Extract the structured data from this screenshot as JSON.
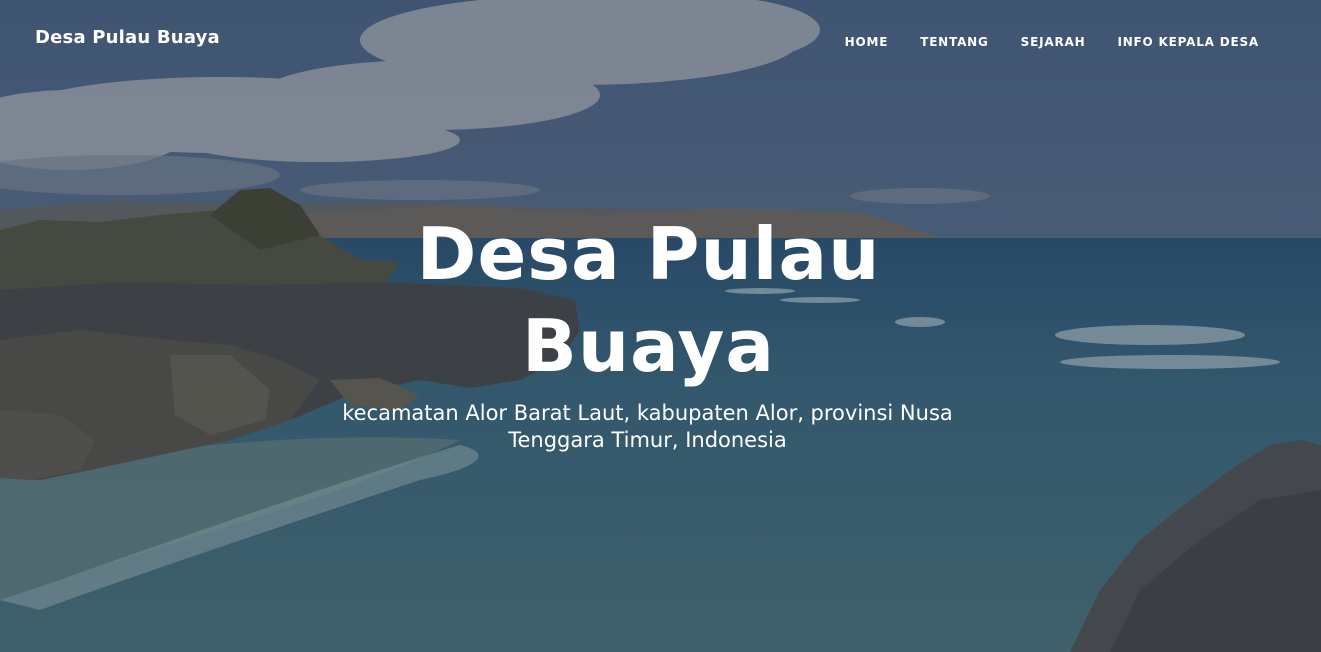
{
  "brand": {
    "name": "Desa Pulau Buaya"
  },
  "nav": {
    "items": [
      {
        "label": "HOME"
      },
      {
        "label": "TENTANG"
      },
      {
        "label": "SEJARAH"
      },
      {
        "label": "INFO KEPALA DESA"
      }
    ]
  },
  "hero": {
    "title": "Desa Pulau Buaya",
    "subtitle": "kecamatan Alor Barat Laut, kabupaten Alor, provinsi Nusa Tenggara Timur, Indonesia",
    "background_description_icon": "coastal-landscape-photo"
  },
  "colors": {
    "sky": "#4f6a8c",
    "sea": "#3e6f86",
    "rock": "#4a4f52",
    "text": "#ffffff"
  }
}
